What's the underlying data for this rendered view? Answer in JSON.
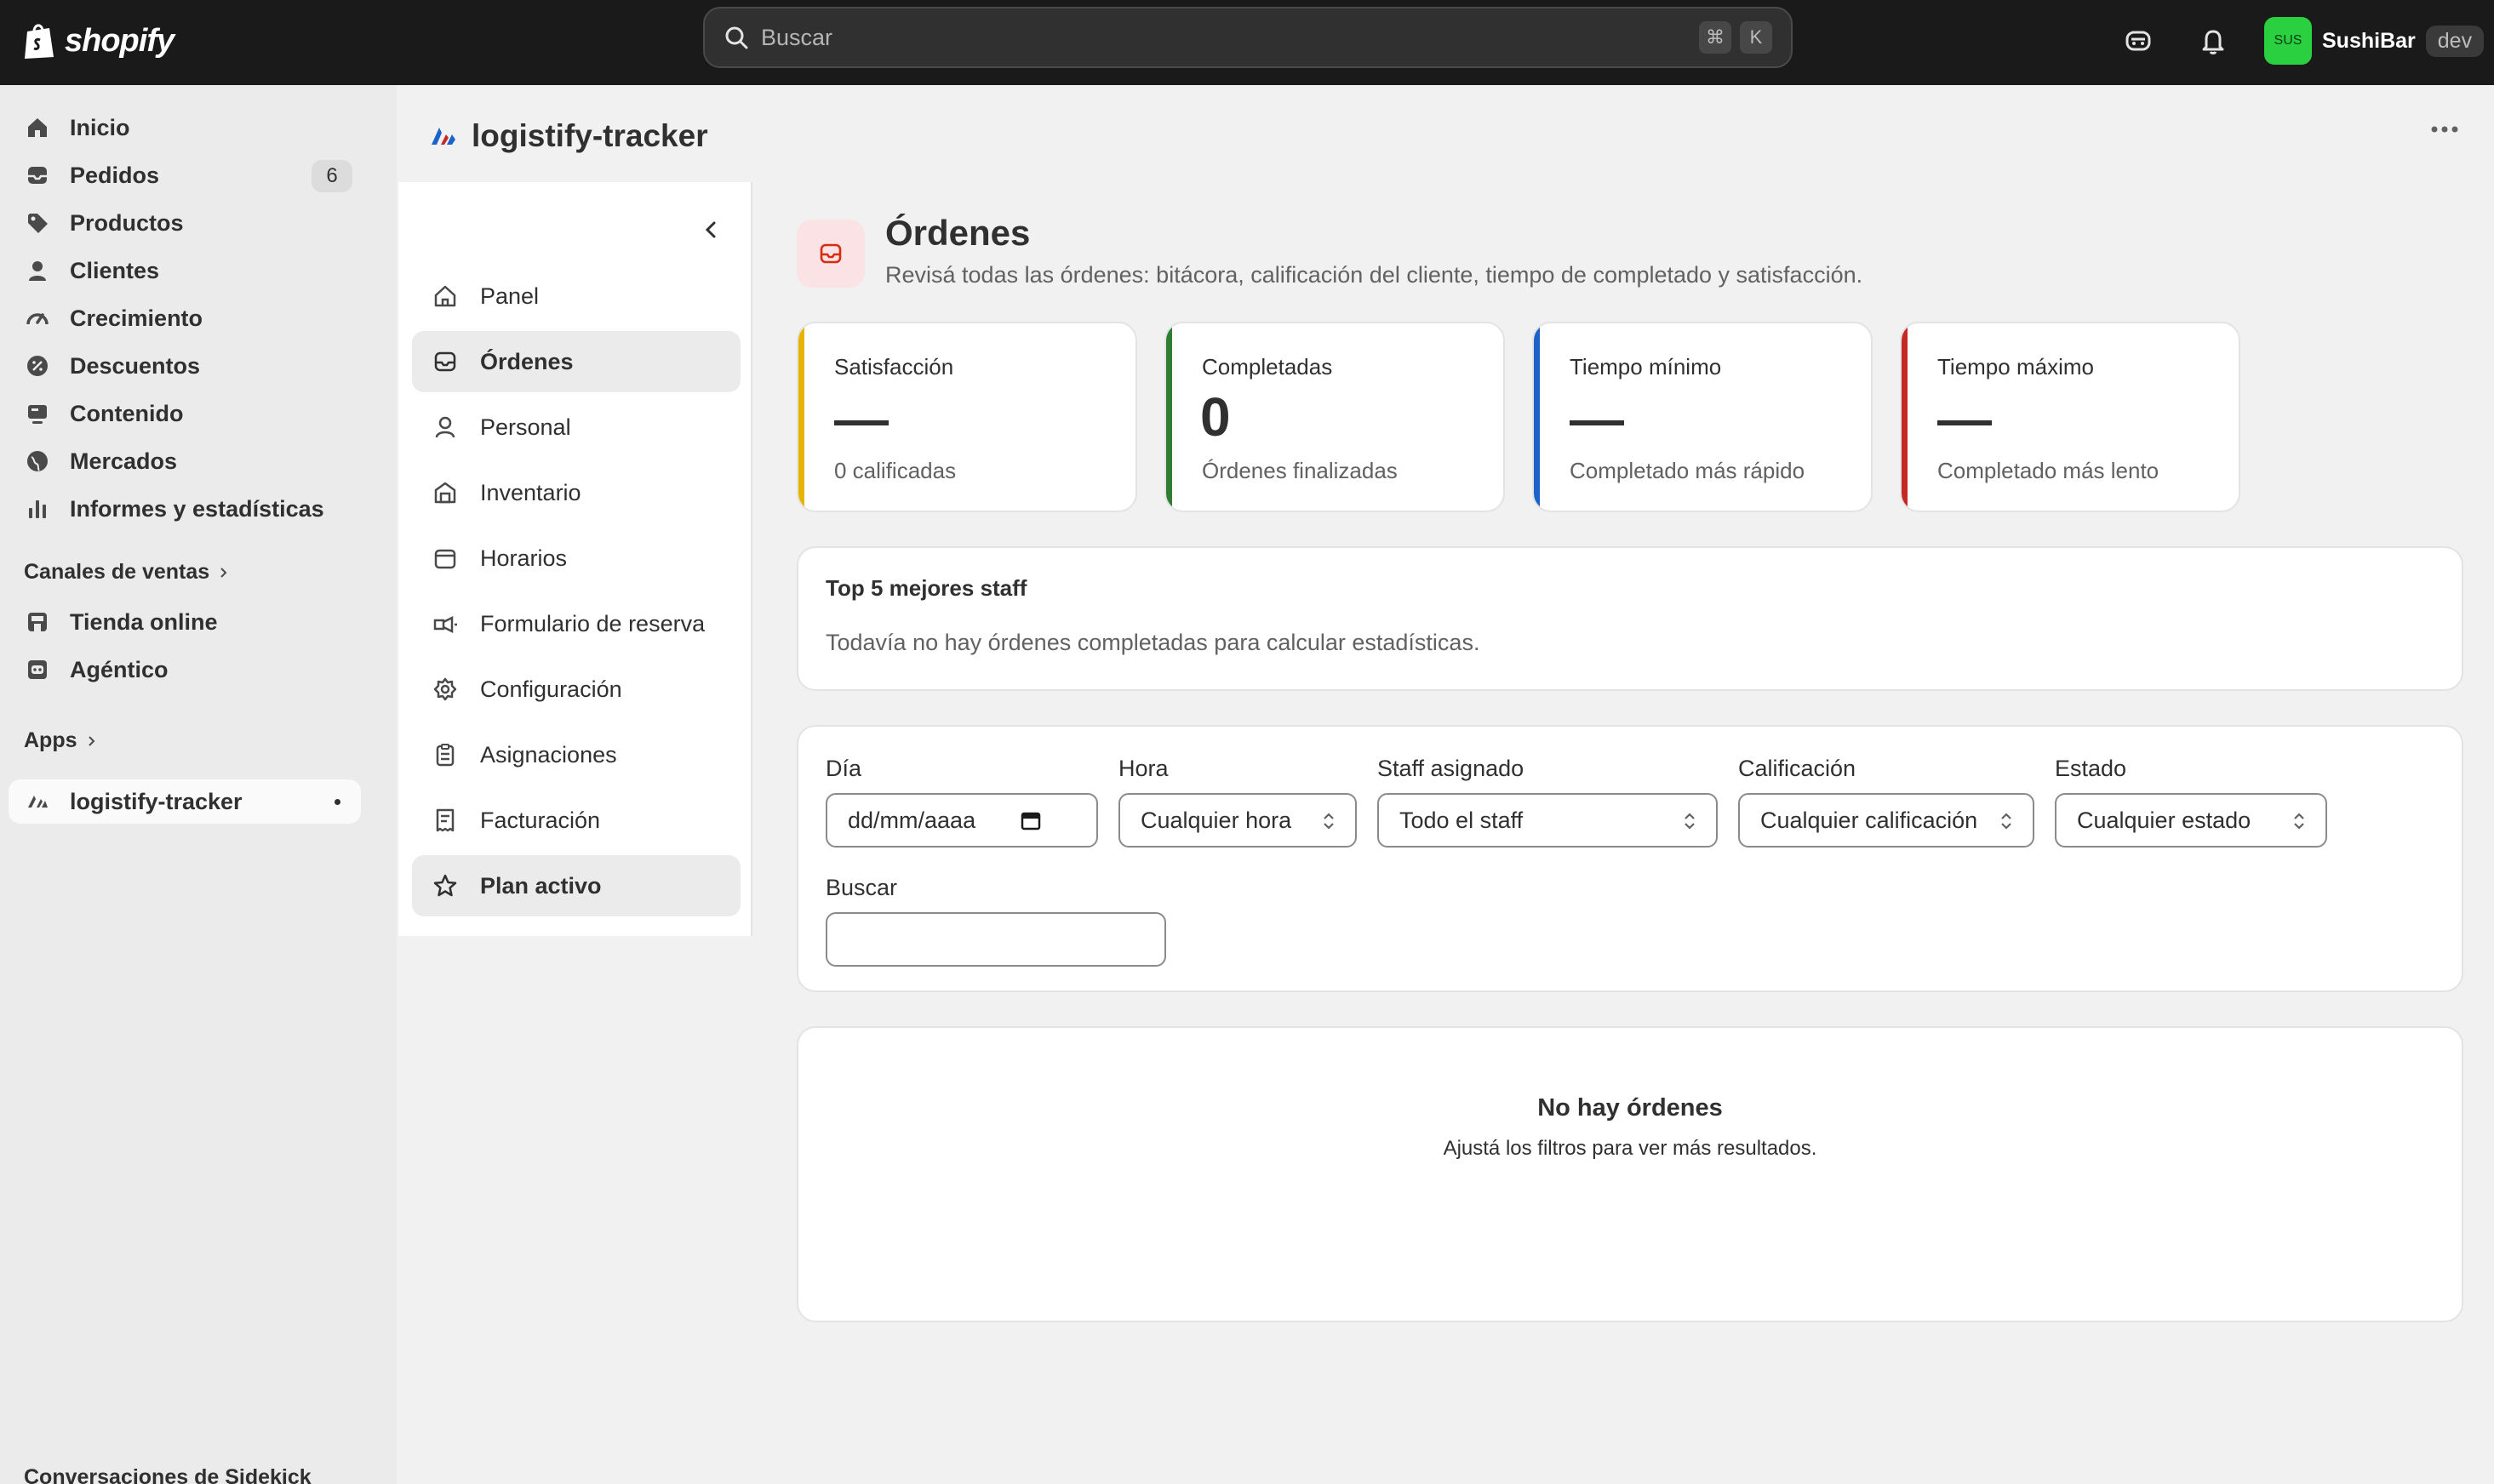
{
  "topbar": {
    "logo_text": "shopify",
    "search_placeholder": "Buscar",
    "shortcut_keys": [
      "⌘",
      "K"
    ],
    "store_initials": "SUS",
    "store_name": "SushiBar",
    "store_env": "dev"
  },
  "sidebar": {
    "items": [
      {
        "label": "Inicio",
        "icon": "home-icon"
      },
      {
        "label": "Pedidos",
        "icon": "inbox-icon",
        "badge": "6"
      },
      {
        "label": "Productos",
        "icon": "tag-icon"
      },
      {
        "label": "Clientes",
        "icon": "person-icon"
      },
      {
        "label": "Crecimiento",
        "icon": "gauge-icon"
      },
      {
        "label": "Descuentos",
        "icon": "discount-icon"
      },
      {
        "label": "Contenido",
        "icon": "content-icon"
      },
      {
        "label": "Mercados",
        "icon": "globe-icon"
      },
      {
        "label": "Informes y estadísticas",
        "icon": "chart-icon"
      }
    ],
    "sales_channels_label": "Canales de ventas",
    "channels": [
      {
        "label": "Tienda online",
        "icon": "store-icon"
      },
      {
        "label": "Agéntico",
        "icon": "robot-icon"
      }
    ],
    "apps_label": "Apps",
    "app_item": "logistify-tracker",
    "sidekick_label": "Conversaciones de Sidekick"
  },
  "app": {
    "title": "logistify-tracker",
    "subnav": [
      {
        "label": "Panel",
        "icon": "home-icon"
      },
      {
        "label": "Órdenes",
        "icon": "inbox-icon"
      },
      {
        "label": "Personal",
        "icon": "person-icon"
      },
      {
        "label": "Inventario",
        "icon": "warehouse-icon"
      },
      {
        "label": "Horarios",
        "icon": "calendar-icon"
      },
      {
        "label": "Formulario de reserva",
        "icon": "form-icon"
      },
      {
        "label": "Configuración",
        "icon": "gear-icon"
      },
      {
        "label": "Asignaciones",
        "icon": "clipboard-icon"
      },
      {
        "label": "Facturación",
        "icon": "receipt-icon"
      },
      {
        "label": "Plan activo",
        "icon": "star-icon"
      }
    ]
  },
  "page": {
    "title": "Órdenes",
    "subtitle": "Revisá todas las órdenes: bitácora, calificación del cliente, tiempo de completado y satisfacción."
  },
  "stats": [
    {
      "title": "Satisfacción",
      "value": "",
      "sub": "0 calificadas",
      "color": "#e6b400"
    },
    {
      "title": "Completadas",
      "value": "0",
      "sub": "Órdenes finalizadas",
      "color": "#2e7d32"
    },
    {
      "title": "Tiempo mínimo",
      "value": "",
      "sub": "Completado más rápido",
      "color": "#1e62c9"
    },
    {
      "title": "Tiempo máximo",
      "value": "",
      "sub": "Completado más lento",
      "color": "#c62828"
    }
  ],
  "top_staff": {
    "title": "Top 5 mejores staff",
    "text": "Todavía no hay órdenes completadas para calcular estadísticas."
  },
  "filters": {
    "day_label": "Día",
    "day_value": "dd/mm/aaaa",
    "hour_label": "Hora",
    "hour_value": "Cualquier hora",
    "staff_label": "Staff asignado",
    "staff_value": "Todo el staff",
    "rating_label": "Calificación",
    "rating_value": "Cualquier calificación",
    "state_label": "Estado",
    "state_value": "Cualquier estado",
    "search_label": "Buscar",
    "search_value": ""
  },
  "empty": {
    "title": "No hay órdenes",
    "text": "Ajustá los filtros para ver más resultados."
  }
}
